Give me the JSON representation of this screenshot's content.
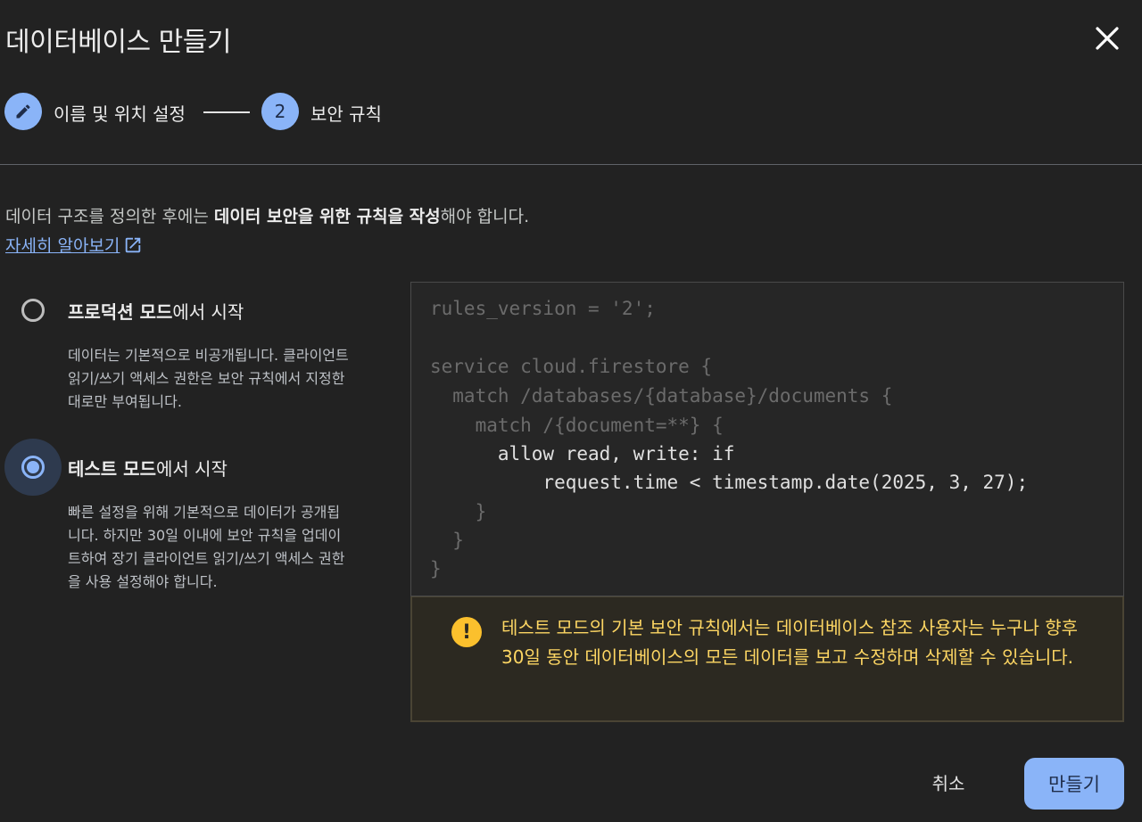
{
  "dialog": {
    "title": "데이터베이스 만들기",
    "close_icon": "close-icon"
  },
  "stepper": {
    "step1": {
      "icon": "pencil-icon",
      "label": "이름 및 위치 설정"
    },
    "step2": {
      "number": "2",
      "label": "보안 규칙"
    }
  },
  "intro": {
    "part1": "데이터 구조를 정의한 후에는 ",
    "bold": "데이터 보안을 위한 규칙을 작성",
    "part2": "해야 합니다.",
    "learn_more": "자세히 알아보기",
    "learn_more_icon": "open-in-new-icon"
  },
  "options": {
    "production": {
      "title_bold": "프로덕션 모드",
      "title_rest": "에서 시작",
      "desc": "데이터는 기본적으로 비공개됩니다. 클라이언트 읽기/쓰기 액세스 권한은 보안 규칙에서 지정한 대로만 부여됩니다.",
      "selected": false
    },
    "test": {
      "title_bold": "테스트 모드",
      "title_rest": "에서 시작",
      "desc": "빠른 설정을 위해 기본적으로 데이터가 공개됩니다. 하지만 30일 이내에 보안 규칙을 업데이트하여 장기 클라이언트 읽기/쓰기 액세스 권한을 사용 설정해야 합니다.",
      "selected": true
    }
  },
  "code": {
    "lines": [
      "rules_version = '2';",
      "",
      "service cloud.firestore {",
      "  match /databases/{database}/documents {",
      "    match /{document=**} {",
      "      allow read, write: if",
      "          request.time < timestamp.date(2025, 3, 27);",
      "    }",
      "  }",
      "}"
    ]
  },
  "warning": {
    "icon": "warning-icon",
    "text": "테스트 모드의 기본 보안 규칙에서는 데이터베이스 참조 사용자는 누구나 향후 30일 동안 데이터베이스의 모든 데이터를 보고 수정하며 삭제할 수 있습니다."
  },
  "actions": {
    "cancel": "취소",
    "create": "만들기"
  },
  "colors": {
    "accent": "#8ab4f8",
    "background": "#222222",
    "warning_text": "#fdd663",
    "warning_icon": "#fbc02d"
  }
}
